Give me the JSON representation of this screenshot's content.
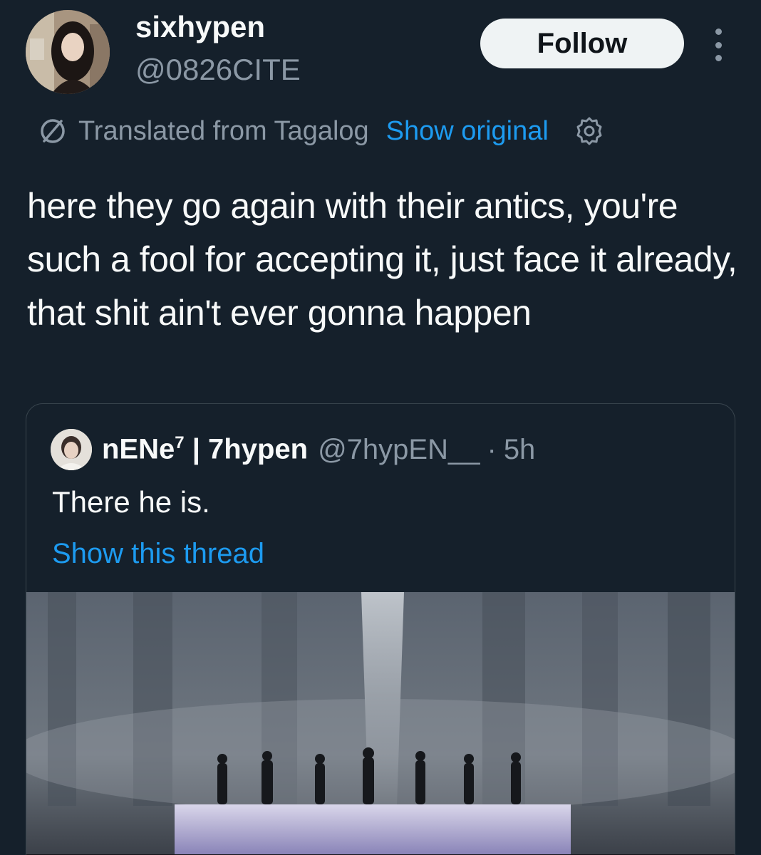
{
  "tweet": {
    "author": {
      "display_name": "sixhypen",
      "handle": "@0826CITE",
      "avatar_icon": "profile-photo"
    },
    "follow_label": "Follow",
    "more_icon": "more-vertical-icon",
    "translation": {
      "icon": "translate-icon",
      "label": "Translated from Tagalog",
      "show_original_label": "Show original",
      "settings_icon": "gear-icon"
    },
    "text": "here they go again with their antics, you're such a fool for accepting it, just face it already, that shit ain't ever gonna happen"
  },
  "quote": {
    "author_name": "nENe",
    "author_name_sup": "7",
    "author_name_rest": " | 7hypen",
    "handle": "@7hypEN__",
    "separator": "·",
    "time": "5h",
    "text": "There he is.",
    "show_thread_label": "Show this thread",
    "media_icon": "concert-stage-image"
  },
  "colors": {
    "background": "#15202b",
    "text": "#f7f9f9",
    "muted": "#8b98a5",
    "link": "#1d9bf0",
    "border": "#38444d",
    "follow_bg": "#eff3f4"
  }
}
